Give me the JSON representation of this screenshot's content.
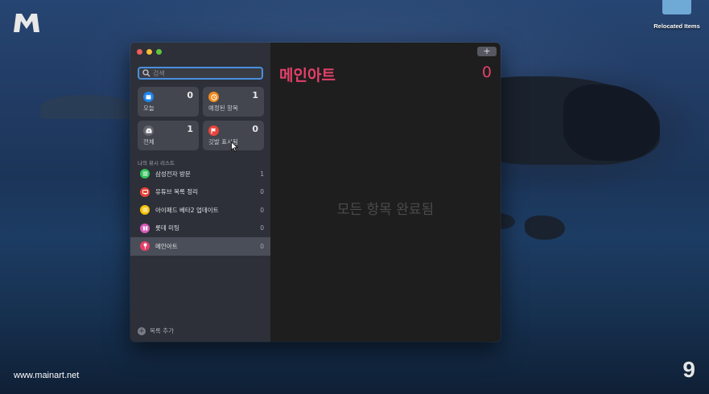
{
  "desktop": {
    "watermark_url": "www.mainart.net",
    "corner_number": "9",
    "relocated_items_label": "Relocated Items",
    "logo_icon": "mainart-logo-icon"
  },
  "search": {
    "placeholder": "검색",
    "value": ""
  },
  "smart_lists": [
    {
      "label": "오늘",
      "count": "0",
      "icon": "calendar-icon",
      "color": "#1e84f0"
    },
    {
      "label": "예정된 항목",
      "count": "1",
      "icon": "clock-icon",
      "color": "#f08a1c"
    },
    {
      "label": "전체",
      "count": "1",
      "icon": "tray-icon",
      "color": "#636570"
    },
    {
      "label": "깃발 표시됨",
      "count": "0",
      "icon": "flag-icon",
      "color": "#e9443a"
    }
  ],
  "my_lists_header": "나의 뮤시 리스트",
  "lists": [
    {
      "name": "삼성전자 방문",
      "count": "1",
      "color": "#30c15a",
      "icon": "list-bullet-icon"
    },
    {
      "name": "유튜브 목록 정리",
      "count": "0",
      "color": "#e9443a",
      "icon": "tv-icon"
    },
    {
      "name": "아이패드 베타2 업데이트",
      "count": "0",
      "color": "#f5c000",
      "icon": "list-bullet-icon"
    },
    {
      "name": "롯데 미팅",
      "count": "0",
      "color": "#d959b7",
      "icon": "gift-icon"
    },
    {
      "name": "메인아트",
      "count": "0",
      "color": "#e5406a",
      "icon": "pin-icon",
      "selected": true
    }
  ],
  "add_list_label": "목록 추가",
  "main": {
    "title": "메인아트",
    "count": "0",
    "empty_message": "모든 항목 완료됨",
    "add_button_label": "+",
    "accent_color": "#e5406a"
  }
}
